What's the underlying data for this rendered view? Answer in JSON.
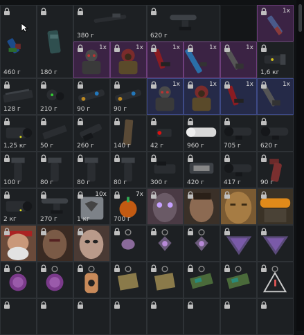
{
  "inventory": {
    "items": [
      {
        "slot": "r0c0",
        "weight": "460 г",
        "count": "",
        "icon": "tactical-rig-icon",
        "tone": ""
      },
      {
        "slot": "r0c1",
        "weight": "180 г",
        "count": "",
        "icon": "magazine-pouch-icon",
        "tone": ""
      },
      {
        "slot": "r0c2",
        "weight": "380 г",
        "count": "",
        "icon": "rifle-scope-long-icon",
        "tone": ""
      },
      {
        "slot": "r0c3",
        "weight": "620 г",
        "count": "",
        "icon": "scope-mount-icon",
        "tone": ""
      },
      {
        "slot": "r0c4",
        "weight": "",
        "count": "",
        "icon": "",
        "tone": "blank"
      },
      {
        "slot": "r0c5",
        "weight": "",
        "count": "1x",
        "icon": "knife-icon",
        "tone": "purple"
      },
      {
        "slot": "r1c2",
        "weight": "",
        "count": "1x",
        "icon": "armored-figure-icon",
        "tone": "purple"
      },
      {
        "slot": "r1c3",
        "weight": "",
        "count": "1x",
        "icon": "hooded-figure-icon",
        "tone": "purple"
      },
      {
        "slot": "r1c4",
        "weight": "",
        "count": "1x",
        "icon": "red-pistol-icon",
        "tone": "purple"
      },
      {
        "slot": "r1c5",
        "weight": "",
        "count": "1x",
        "icon": "blue-rifle-icon",
        "tone": "purple"
      },
      {
        "slot": "r1c6",
        "weight": "",
        "count": "1x",
        "icon": "grey-pistol-icon",
        "tone": "purple"
      },
      {
        "slot": "r1c7",
        "weight": "1,6 кг",
        "count": "",
        "icon": "tactical-light-icon",
        "tone": ""
      },
      {
        "slot": "r2c0",
        "weight": "128 г",
        "count": "",
        "icon": "rail-handguard-icon",
        "tone": ""
      },
      {
        "slot": "r2c1",
        "weight": "210 г",
        "count": "",
        "icon": "night-vision-icon",
        "tone": ""
      },
      {
        "slot": "r2c2",
        "weight": "90 г",
        "count": "",
        "icon": "barrel-mount-icon",
        "tone": ""
      },
      {
        "slot": "r2c3",
        "weight": "90 г",
        "count": "",
        "icon": "barrel-mount-icon",
        "tone": ""
      },
      {
        "slot": "r2c4",
        "weight": "",
        "count": "1x",
        "icon": "armored-figure-icon",
        "tone": "blue"
      },
      {
        "slot": "r2c5",
        "weight": "",
        "count": "1x",
        "icon": "hooded-figure-icon",
        "tone": "blue"
      },
      {
        "slot": "r2c6",
        "weight": "",
        "count": "1x",
        "icon": "red-pistol-icon",
        "tone": "blue"
      },
      {
        "slot": "r2c7",
        "weight": "",
        "count": "1x",
        "icon": "grey-pistol-icon",
        "tone": "blue"
      },
      {
        "slot": "r3c0",
        "weight": "1,25 кг",
        "count": "",
        "icon": "thermal-sight-icon",
        "tone": ""
      },
      {
        "slot": "r3c1",
        "weight": "50 г",
        "count": "",
        "icon": "rail-segment-icon",
        "tone": ""
      },
      {
        "slot": "r3c2",
        "weight": "260 г",
        "count": "",
        "icon": "flashlight-icon",
        "tone": ""
      },
      {
        "slot": "r3c3",
        "weight": "140 г",
        "count": "",
        "icon": "magazine-icon",
        "tone": ""
      },
      {
        "slot": "r3c4",
        "weight": "42 г",
        "count": "",
        "icon": "laser-module-icon",
        "tone": ""
      },
      {
        "slot": "r3c5",
        "weight": "960 г",
        "count": "",
        "icon": "white-scope-icon",
        "tone": ""
      },
      {
        "slot": "r3c6",
        "weight": "705 г",
        "count": "",
        "icon": "dark-scope-icon",
        "tone": ""
      },
      {
        "slot": "r3c7",
        "weight": "620 г",
        "count": "",
        "icon": "dark-scope-icon",
        "tone": ""
      },
      {
        "slot": "r4c0",
        "weight": "100 г",
        "count": "",
        "icon": "foregrip-icon",
        "tone": ""
      },
      {
        "slot": "r4c1",
        "weight": "80 г",
        "count": "",
        "icon": "foregrip-icon",
        "tone": ""
      },
      {
        "slot": "r4c2",
        "weight": "80 г",
        "count": "",
        "icon": "foregrip-icon",
        "tone": ""
      },
      {
        "slot": "r4c3",
        "weight": "80 г",
        "count": "",
        "icon": "foregrip-icon",
        "tone": ""
      },
      {
        "slot": "r4c4",
        "weight": "300 г",
        "count": "",
        "icon": "red-dot-sight-icon",
        "tone": ""
      },
      {
        "slot": "r4c5",
        "weight": "420 г",
        "count": "",
        "icon": "holo-sight-icon",
        "tone": ""
      },
      {
        "slot": "r4c6",
        "weight": "417 г",
        "count": "",
        "icon": "dark-scope-icon",
        "tone": ""
      },
      {
        "slot": "r4c7",
        "weight": "90 г",
        "count": "",
        "icon": "pistol-grip-icon",
        "tone": ""
      },
      {
        "slot": "r5c0",
        "weight": "2 кг",
        "count": "",
        "icon": "thermal-sight-icon",
        "tone": ""
      },
      {
        "slot": "r5c1",
        "weight": "270 г",
        "count": "",
        "icon": "scope-mount-icon",
        "tone": ""
      },
      {
        "slot": "r5c2",
        "weight": "1 кг",
        "count": "10x",
        "icon": "shield-can-icon",
        "tone": ""
      },
      {
        "slot": "r5c3",
        "weight": "700 г",
        "count": "7x",
        "icon": "pumpkin-icon",
        "tone": ""
      },
      {
        "slot": "r5c4",
        "weight": "",
        "count": "",
        "icon": "glowing-eyes-face-icon",
        "tone": ""
      },
      {
        "slot": "r5c5",
        "weight": "",
        "count": "",
        "icon": "man-face-icon",
        "tone": ""
      },
      {
        "slot": "r5c6",
        "weight": "",
        "count": "",
        "icon": "wooden-mask-icon",
        "tone": ""
      },
      {
        "slot": "r5c7",
        "weight": "",
        "count": "",
        "icon": "goggles-mask-icon",
        "tone": ""
      },
      {
        "slot": "r6c0",
        "weight": "",
        "count": "",
        "icon": "bearded-face-icon",
        "tone": ""
      },
      {
        "slot": "r6c1",
        "weight": "",
        "count": "",
        "icon": "scarred-face-icon",
        "tone": ""
      },
      {
        "slot": "r6c2",
        "weight": "",
        "count": "",
        "icon": "balaclava-face-icon",
        "tone": ""
      },
      {
        "slot": "r6c3",
        "weight": "",
        "count": "",
        "icon": "purple-charm-icon",
        "tone": ""
      },
      {
        "slot": "r6c4",
        "weight": "",
        "count": "",
        "icon": "star-charm-icon",
        "tone": ""
      },
      {
        "slot": "r6c5",
        "weight": "",
        "count": "",
        "icon": "star-charm-icon",
        "tone": ""
      },
      {
        "slot": "r6c6",
        "weight": "",
        "count": "",
        "icon": "triangle-charm-icon",
        "tone": ""
      },
      {
        "slot": "r6c7",
        "weight": "",
        "count": "",
        "icon": "triangle-charm-icon",
        "tone": ""
      },
      {
        "slot": "r7c0",
        "weight": "",
        "count": "",
        "icon": "round-charm-icon",
        "tone": ""
      },
      {
        "slot": "r7c1",
        "weight": "",
        "count": "",
        "icon": "round-charm-icon",
        "tone": ""
      },
      {
        "slot": "r7c2",
        "weight": "",
        "count": "",
        "icon": "dog-tag-icon",
        "tone": ""
      },
      {
        "slot": "r7c3",
        "weight": "",
        "count": "",
        "icon": "map-charm-icon",
        "tone": ""
      },
      {
        "slot": "r7c4",
        "weight": "",
        "count": "",
        "icon": "map-charm-icon",
        "tone": ""
      },
      {
        "slot": "r7c5",
        "weight": "",
        "count": "",
        "icon": "camo-charm-icon",
        "tone": ""
      },
      {
        "slot": "r7c6",
        "weight": "",
        "count": "",
        "icon": "camo-charm-icon",
        "tone": ""
      },
      {
        "slot": "r7c7",
        "weight": "",
        "count": "",
        "icon": "warning-triangle-icon",
        "tone": ""
      },
      {
        "slot": "r8c0",
        "weight": "",
        "count": "",
        "icon": "lock-only",
        "tone": ""
      },
      {
        "slot": "r8c1",
        "weight": "",
        "count": "",
        "icon": "lock-only",
        "tone": ""
      },
      {
        "slot": "r8c2",
        "weight": "",
        "count": "",
        "icon": "lock-only",
        "tone": ""
      },
      {
        "slot": "r8c3",
        "weight": "",
        "count": "",
        "icon": "lock-only",
        "tone": ""
      },
      {
        "slot": "r8c4",
        "weight": "",
        "count": "",
        "icon": "lock-only",
        "tone": ""
      },
      {
        "slot": "r8c5",
        "weight": "",
        "count": "",
        "icon": "lock-only",
        "tone": ""
      },
      {
        "slot": "r8c6",
        "weight": "",
        "count": "",
        "icon": "lock-only",
        "tone": ""
      },
      {
        "slot": "r8c7",
        "weight": "",
        "count": "",
        "icon": "lock-only",
        "tone": ""
      }
    ]
  },
  "colors": {
    "purple_rarity": "#3b2344",
    "blue_rarity": "#252a48",
    "cell": "#1d2023",
    "weight_text": "#d0d0d0"
  }
}
